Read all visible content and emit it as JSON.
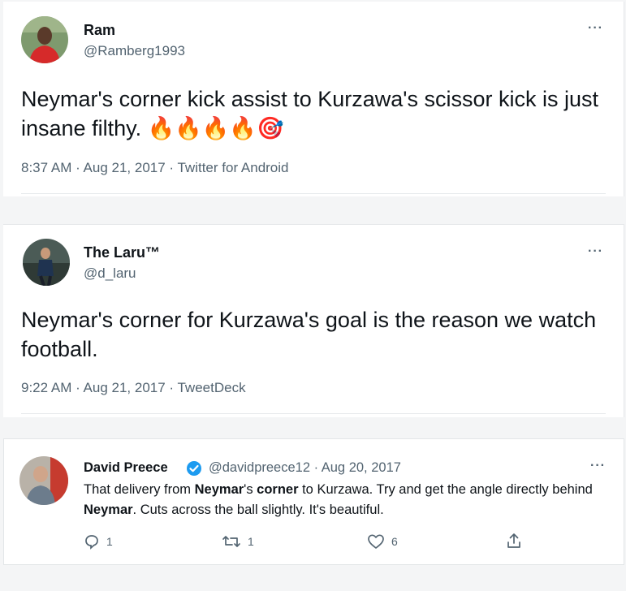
{
  "tweets": [
    {
      "name": "Ram",
      "handle": "@Ramberg1993",
      "text": "Neymar's corner kick assist to Kurzawa's scissor kick is just insane filthy. 🔥🔥🔥🔥🎯",
      "meta": "8:37 AM · Aug 21, 2017 · Twitter for Android",
      "more": "···"
    },
    {
      "name": "The Laru™",
      "handle": "@d_laru",
      "text": "Neymar's corner for Kurzawa's goal is the reason we watch football.",
      "meta": "9:22 AM · Aug 21, 2017 · TweetDeck",
      "more": "···"
    }
  ],
  "reply": {
    "name": "David Preece",
    "handle_date": "@davidpreece12 · Aug 20, 2017",
    "more": "···",
    "text_segments": [
      {
        "t": "That delivery from ",
        "b": false
      },
      {
        "t": "Neymar",
        "b": true
      },
      {
        "t": "'s ",
        "b": false
      },
      {
        "t": "corner",
        "b": true
      },
      {
        "t": " to Kurzawa. Try and get the angle directly behind ",
        "b": false
      },
      {
        "t": "Neymar",
        "b": true
      },
      {
        "t": ". Cuts across the ball slightly. It's beautiful.",
        "b": false
      }
    ],
    "replies": "1",
    "retweets": "1",
    "likes": "6",
    "verified_color": "#1d9bf0"
  },
  "colors": {
    "text": "#0f1419",
    "secondary": "#536471",
    "background": "#f4f5f6"
  }
}
